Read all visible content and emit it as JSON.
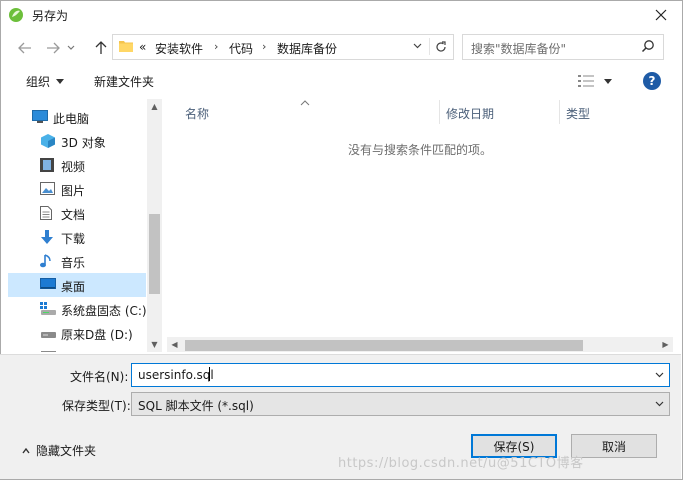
{
  "window": {
    "title": "另存为"
  },
  "address": {
    "prefix": "«",
    "crumbs": [
      "安装软件",
      "代码",
      "数据库备份"
    ],
    "separator": "›"
  },
  "search": {
    "placeholder": "搜索\"数据库备份\""
  },
  "toolbar": {
    "organize": "组织",
    "new_folder": "新建文件夹",
    "help": "?"
  },
  "tree": {
    "items": [
      {
        "label": "此电脑",
        "icon": "computer-icon"
      },
      {
        "label": "3D 对象",
        "icon": "cube-icon"
      },
      {
        "label": "视频",
        "icon": "film-icon"
      },
      {
        "label": "图片",
        "icon": "image-icon"
      },
      {
        "label": "文档",
        "icon": "document-icon"
      },
      {
        "label": "下载",
        "icon": "download-arrow-icon"
      },
      {
        "label": "音乐",
        "icon": "music-note-icon"
      },
      {
        "label": "桌面",
        "icon": "desktop-icon",
        "selected": true
      },
      {
        "label": "系统盘固态 (C:)",
        "icon": "windows-drive-icon"
      },
      {
        "label": "原来D盘 (D:)",
        "icon": "drive-icon"
      }
    ]
  },
  "columns": {
    "name": "名称",
    "date": "修改日期",
    "type": "类型"
  },
  "empty_message": "没有与搜索条件匹配的项。",
  "form": {
    "filename_label": "文件名(N):",
    "filename_value": "usersinfo.sql",
    "filetype_label": "保存类型(T):",
    "filetype_value": "SQL 脚本文件 (*.sql)"
  },
  "buttons": {
    "save": "保存(S)",
    "cancel": "取消",
    "hide_folders": "隐藏文件夹"
  },
  "watermark": "https://blog.csdn.net/u@51CTO博客",
  "colors": {
    "accent": "#0078d7",
    "selection": "#cce8ff",
    "help": "#1e5ba6"
  }
}
